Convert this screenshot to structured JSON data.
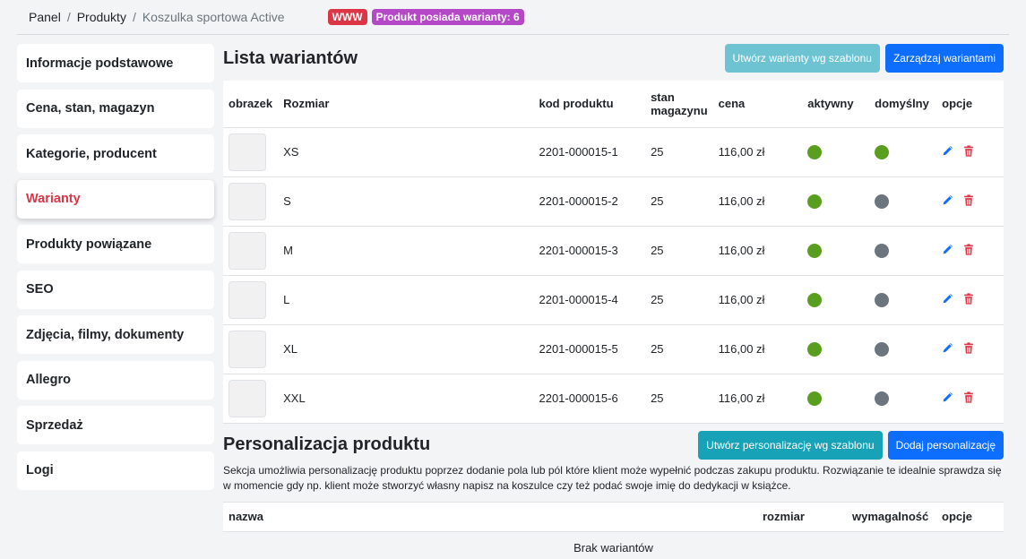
{
  "breadcrumb": {
    "panel": "Panel",
    "produkty": "Produkty",
    "current": "Koszulka sportowa Active",
    "sep": "/"
  },
  "badges": {
    "www": "WWW",
    "variants": "Produkt posiada warianty: 6"
  },
  "sidebar": {
    "items": [
      {
        "label": "Informacje podstawowe"
      },
      {
        "label": "Cena, stan, magazyn"
      },
      {
        "label": "Kategorie, producent"
      },
      {
        "label": "Warianty"
      },
      {
        "label": "Produkty powiązane"
      },
      {
        "label": "SEO"
      },
      {
        "label": "Zdjęcia, filmy, dokumenty"
      },
      {
        "label": "Allegro"
      },
      {
        "label": "Sprzedaż"
      },
      {
        "label": "Logi"
      }
    ],
    "active_index": 3
  },
  "variants": {
    "title": "Lista wariantów",
    "btn_template": "Utwórz warianty wg szablonu",
    "btn_manage": "Zarządzaj wariantami",
    "headers": {
      "image": "obrazek",
      "size": "Rozmiar",
      "code": "kod produktu",
      "stock_line1": "stan",
      "stock_line2": "magazynu",
      "price": "cena",
      "active": "aktywny",
      "default": "domyślny",
      "options": "opcje"
    },
    "rows": [
      {
        "size": "XS",
        "code": "2201-000015-1",
        "stock": "25",
        "price": "116,00 zł",
        "active": true,
        "default": true
      },
      {
        "size": "S",
        "code": "2201-000015-2",
        "stock": "25",
        "price": "116,00 zł",
        "active": true,
        "default": false
      },
      {
        "size": "M",
        "code": "2201-000015-3",
        "stock": "25",
        "price": "116,00 zł",
        "active": true,
        "default": false
      },
      {
        "size": "L",
        "code": "2201-000015-4",
        "stock": "25",
        "price": "116,00 zł",
        "active": true,
        "default": false
      },
      {
        "size": "XL",
        "code": "2201-000015-5",
        "stock": "25",
        "price": "116,00 zł",
        "active": true,
        "default": false
      },
      {
        "size": "XXL",
        "code": "2201-000015-6",
        "stock": "25",
        "price": "116,00 zł",
        "active": true,
        "default": false
      }
    ]
  },
  "personalization": {
    "title": "Personalizacja produktu",
    "btn_template": "Utwórz personalizację wg szablonu",
    "btn_add": "Dodaj personalizację",
    "description": "Sekcja umożliwia personalizację produktu poprzez dodanie pola lub pól które klient może wypełnić podczas zakupu produktu. Rozwiązanie te idealnie sprawdza się w momencie gdy np. klient może stworzyć własny napisz na koszulce czy też podać swoje imię do dedykacji w książce.",
    "headers": {
      "name": "nazwa",
      "size": "rozmiar",
      "required": "wymagalność",
      "options": "opcje"
    },
    "empty": "Brak wariantów"
  },
  "colors": {
    "active_dot": "#5a9e20",
    "inactive_dot": "#6c757d",
    "edit_icon": "#0d6efd",
    "delete_icon": "#dc3545",
    "accent": "#dc3545"
  },
  "icons": {
    "edit": "pencil-icon",
    "delete": "trash-icon"
  }
}
